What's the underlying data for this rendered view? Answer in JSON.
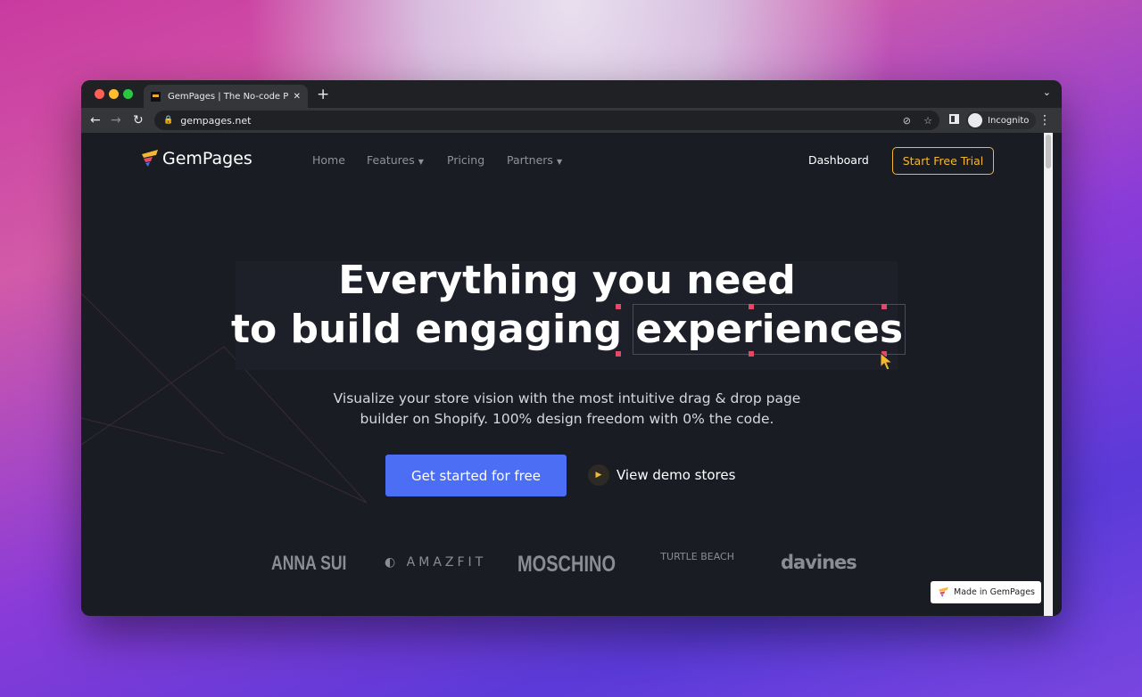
{
  "browser": {
    "tab_title": "GemPages | The No-code Page Builder",
    "url": "gempages.net",
    "profile": "Incognito"
  },
  "nav": {
    "brand": "GemPages",
    "links": [
      {
        "label": "Home"
      },
      {
        "label": "Features",
        "dropdown": true
      },
      {
        "label": "Pricing"
      },
      {
        "label": "Partners",
        "dropdown": true
      }
    ],
    "dashboard": "Dashboard",
    "trial": "Start Free Trial"
  },
  "hero": {
    "line1": "Everything you need",
    "line2a": "to build engaging",
    "line2b": "experiences",
    "subtitle1": "Visualize your store vision with the most intuitive drag & drop page",
    "subtitle2": "builder on Shopify. 100% design freedom with 0% the code.",
    "cta": "Get started for free",
    "demo": "View demo stores"
  },
  "brands": [
    "ANNA SUI",
    "AMAZFIT",
    "MOSCHINO",
    "TURTLE BEACH",
    "davines"
  ],
  "badge": "Made in GemPages",
  "colors": {
    "accent": "#f5b731",
    "primary": "#4b6ef5",
    "page_bg": "#1a1c23"
  }
}
